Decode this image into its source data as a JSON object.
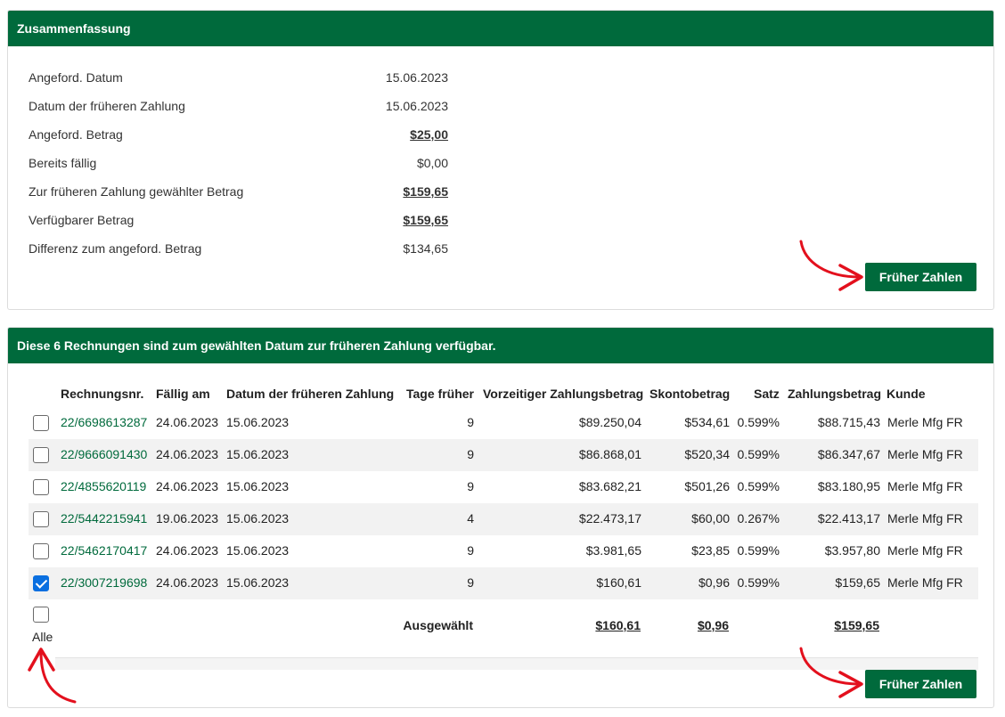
{
  "summary": {
    "title": "Zusammenfassung",
    "rows": [
      {
        "label": "Angeford. Datum",
        "value": "15.06.2023"
      },
      {
        "label": "Datum der früheren Zahlung",
        "value": "15.06.2023"
      },
      {
        "label": "Angeford. Betrag",
        "value": "$25,00"
      },
      {
        "label": "Bereits fällig",
        "value": "$0,00"
      },
      {
        "label": "Zur früheren Zahlung gewählter Betrag",
        "value": "$159,65"
      },
      {
        "label": "Verfügbarer Betrag",
        "value": "$159,65"
      },
      {
        "label": "Differenz zum angeford. Betrag",
        "value": "$134,65"
      }
    ],
    "pay_button": "Früher Zahlen"
  },
  "invoices": {
    "title": "Diese 6 Rechnungen sind zum gewählten Datum zur früheren Zahlung verfügbar.",
    "columns": [
      "Rechnungsnr.",
      "Fällig am",
      "Datum der früheren Zahlung",
      "Tage früher",
      "Vorzeitiger Zahlungsbetrag",
      "Skontobetrag",
      "Satz",
      "Zahlungsbetrag",
      "Kunde"
    ],
    "rows": [
      {
        "checked": false,
        "nr": "22/6698613287",
        "due": "24.06.2023",
        "early": "15.06.2023",
        "days": "9",
        "early_amount": "$89.250,04",
        "discount": "$534,61",
        "rate": "0.599%",
        "payment": "$88.715,43",
        "customer": "Merle Mfg FR"
      },
      {
        "checked": false,
        "nr": "22/9666091430",
        "due": "24.06.2023",
        "early": "15.06.2023",
        "days": "9",
        "early_amount": "$86.868,01",
        "discount": "$520,34",
        "rate": "0.599%",
        "payment": "$86.347,67",
        "customer": "Merle Mfg FR"
      },
      {
        "checked": false,
        "nr": "22/4855620119",
        "due": "24.06.2023",
        "early": "15.06.2023",
        "days": "9",
        "early_amount": "$83.682,21",
        "discount": "$501,26",
        "rate": "0.599%",
        "payment": "$83.180,95",
        "customer": "Merle Mfg FR"
      },
      {
        "checked": false,
        "nr": "22/5442215941",
        "due": "19.06.2023",
        "early": "15.06.2023",
        "days": "4",
        "early_amount": "$22.473,17",
        "discount": "$60,00",
        "rate": "0.267%",
        "payment": "$22.413,17",
        "customer": "Merle Mfg FR"
      },
      {
        "checked": false,
        "nr": "22/5462170417",
        "due": "24.06.2023",
        "early": "15.06.2023",
        "days": "9",
        "early_amount": "$3.981,65",
        "discount": "$23,85",
        "rate": "0.599%",
        "payment": "$3.957,80",
        "customer": "Merle Mfg FR"
      },
      {
        "checked": true,
        "nr": "22/3007219698",
        "due": "24.06.2023",
        "early": "15.06.2023",
        "days": "9",
        "early_amount": "$160,61",
        "discount": "$0,96",
        "rate": "0.599%",
        "payment": "$159,65",
        "customer": "Merle Mfg FR"
      }
    ],
    "select_all_label": "Alle",
    "selected_label": "Ausgewählt",
    "selected_early_amount": "$160,61",
    "selected_discount": "$0,96",
    "selected_payment": "$159,65",
    "pay_button": "Früher Zahlen"
  },
  "colors": {
    "brand_green": "#006a3c",
    "arrow_red": "#e3101d",
    "checkbox_blue": "#0a6fe0"
  },
  "icons": [
    "arrow-annotation-icon",
    "checkbox-checked-icon",
    "checkbox-unchecked-icon"
  ]
}
